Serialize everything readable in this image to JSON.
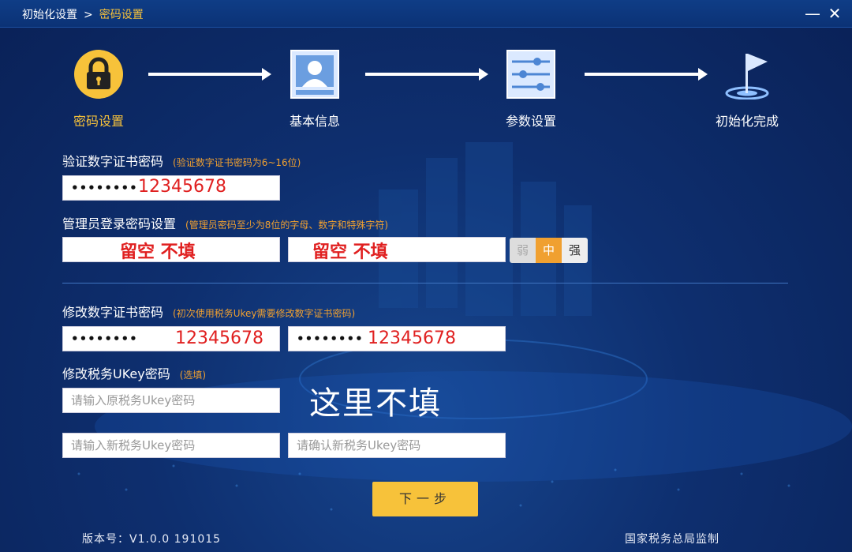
{
  "breadcrumb": {
    "root": "初始化设置",
    "separator": ">",
    "current": "密码设置"
  },
  "window": {
    "minimize": "—",
    "close": "✕"
  },
  "steps": [
    {
      "label": "密码设置",
      "icon": "lock-icon",
      "active": true
    },
    {
      "label": "基本信息",
      "icon": "user-card-icon",
      "active": false
    },
    {
      "label": "参数设置",
      "icon": "sliders-icon",
      "active": false
    },
    {
      "label": "初始化完成",
      "icon": "flag-icon",
      "active": false
    }
  ],
  "verify_cert": {
    "label": "验证数字证书密码",
    "hint": "(验证数字证书密码为6~16位)",
    "value_masked": "••••••••",
    "annotation": "12345678"
  },
  "admin_login": {
    "label": "管理员登录密码设置",
    "hint": "(管理员密码至少为8位的字母、数字和特殊字符)",
    "annotation_1": "留空 不填",
    "annotation_2": "留空 不填",
    "strength": {
      "weak": "弱",
      "mid": "中",
      "strong": "强"
    }
  },
  "modify_cert": {
    "label": "修改数字证书密码",
    "hint": "(初次使用税务Ukey需要修改数字证书密码)",
    "value_masked_1": "••••••••",
    "value_masked_2": "••••••••",
    "annotation_1": "12345678",
    "annotation_2": "12345678"
  },
  "modify_ukey": {
    "label": "修改税务UKey密码",
    "hint": "(选填)",
    "placeholder_old": "请输入原税务Ukey密码",
    "placeholder_new": "请输入新税务Ukey密码",
    "placeholder_confirm": "请确认新税务Ukey密码",
    "annotation": "这里不填"
  },
  "next_button": "下一步",
  "footer": {
    "version": "版本号：V1.0.0 191015",
    "supervisor": "国家税务总局监制"
  },
  "colors": {
    "accent": "#f7c23a",
    "hint": "#f0a030",
    "annotation": "#e02020",
    "background": "#0e2f6f"
  }
}
